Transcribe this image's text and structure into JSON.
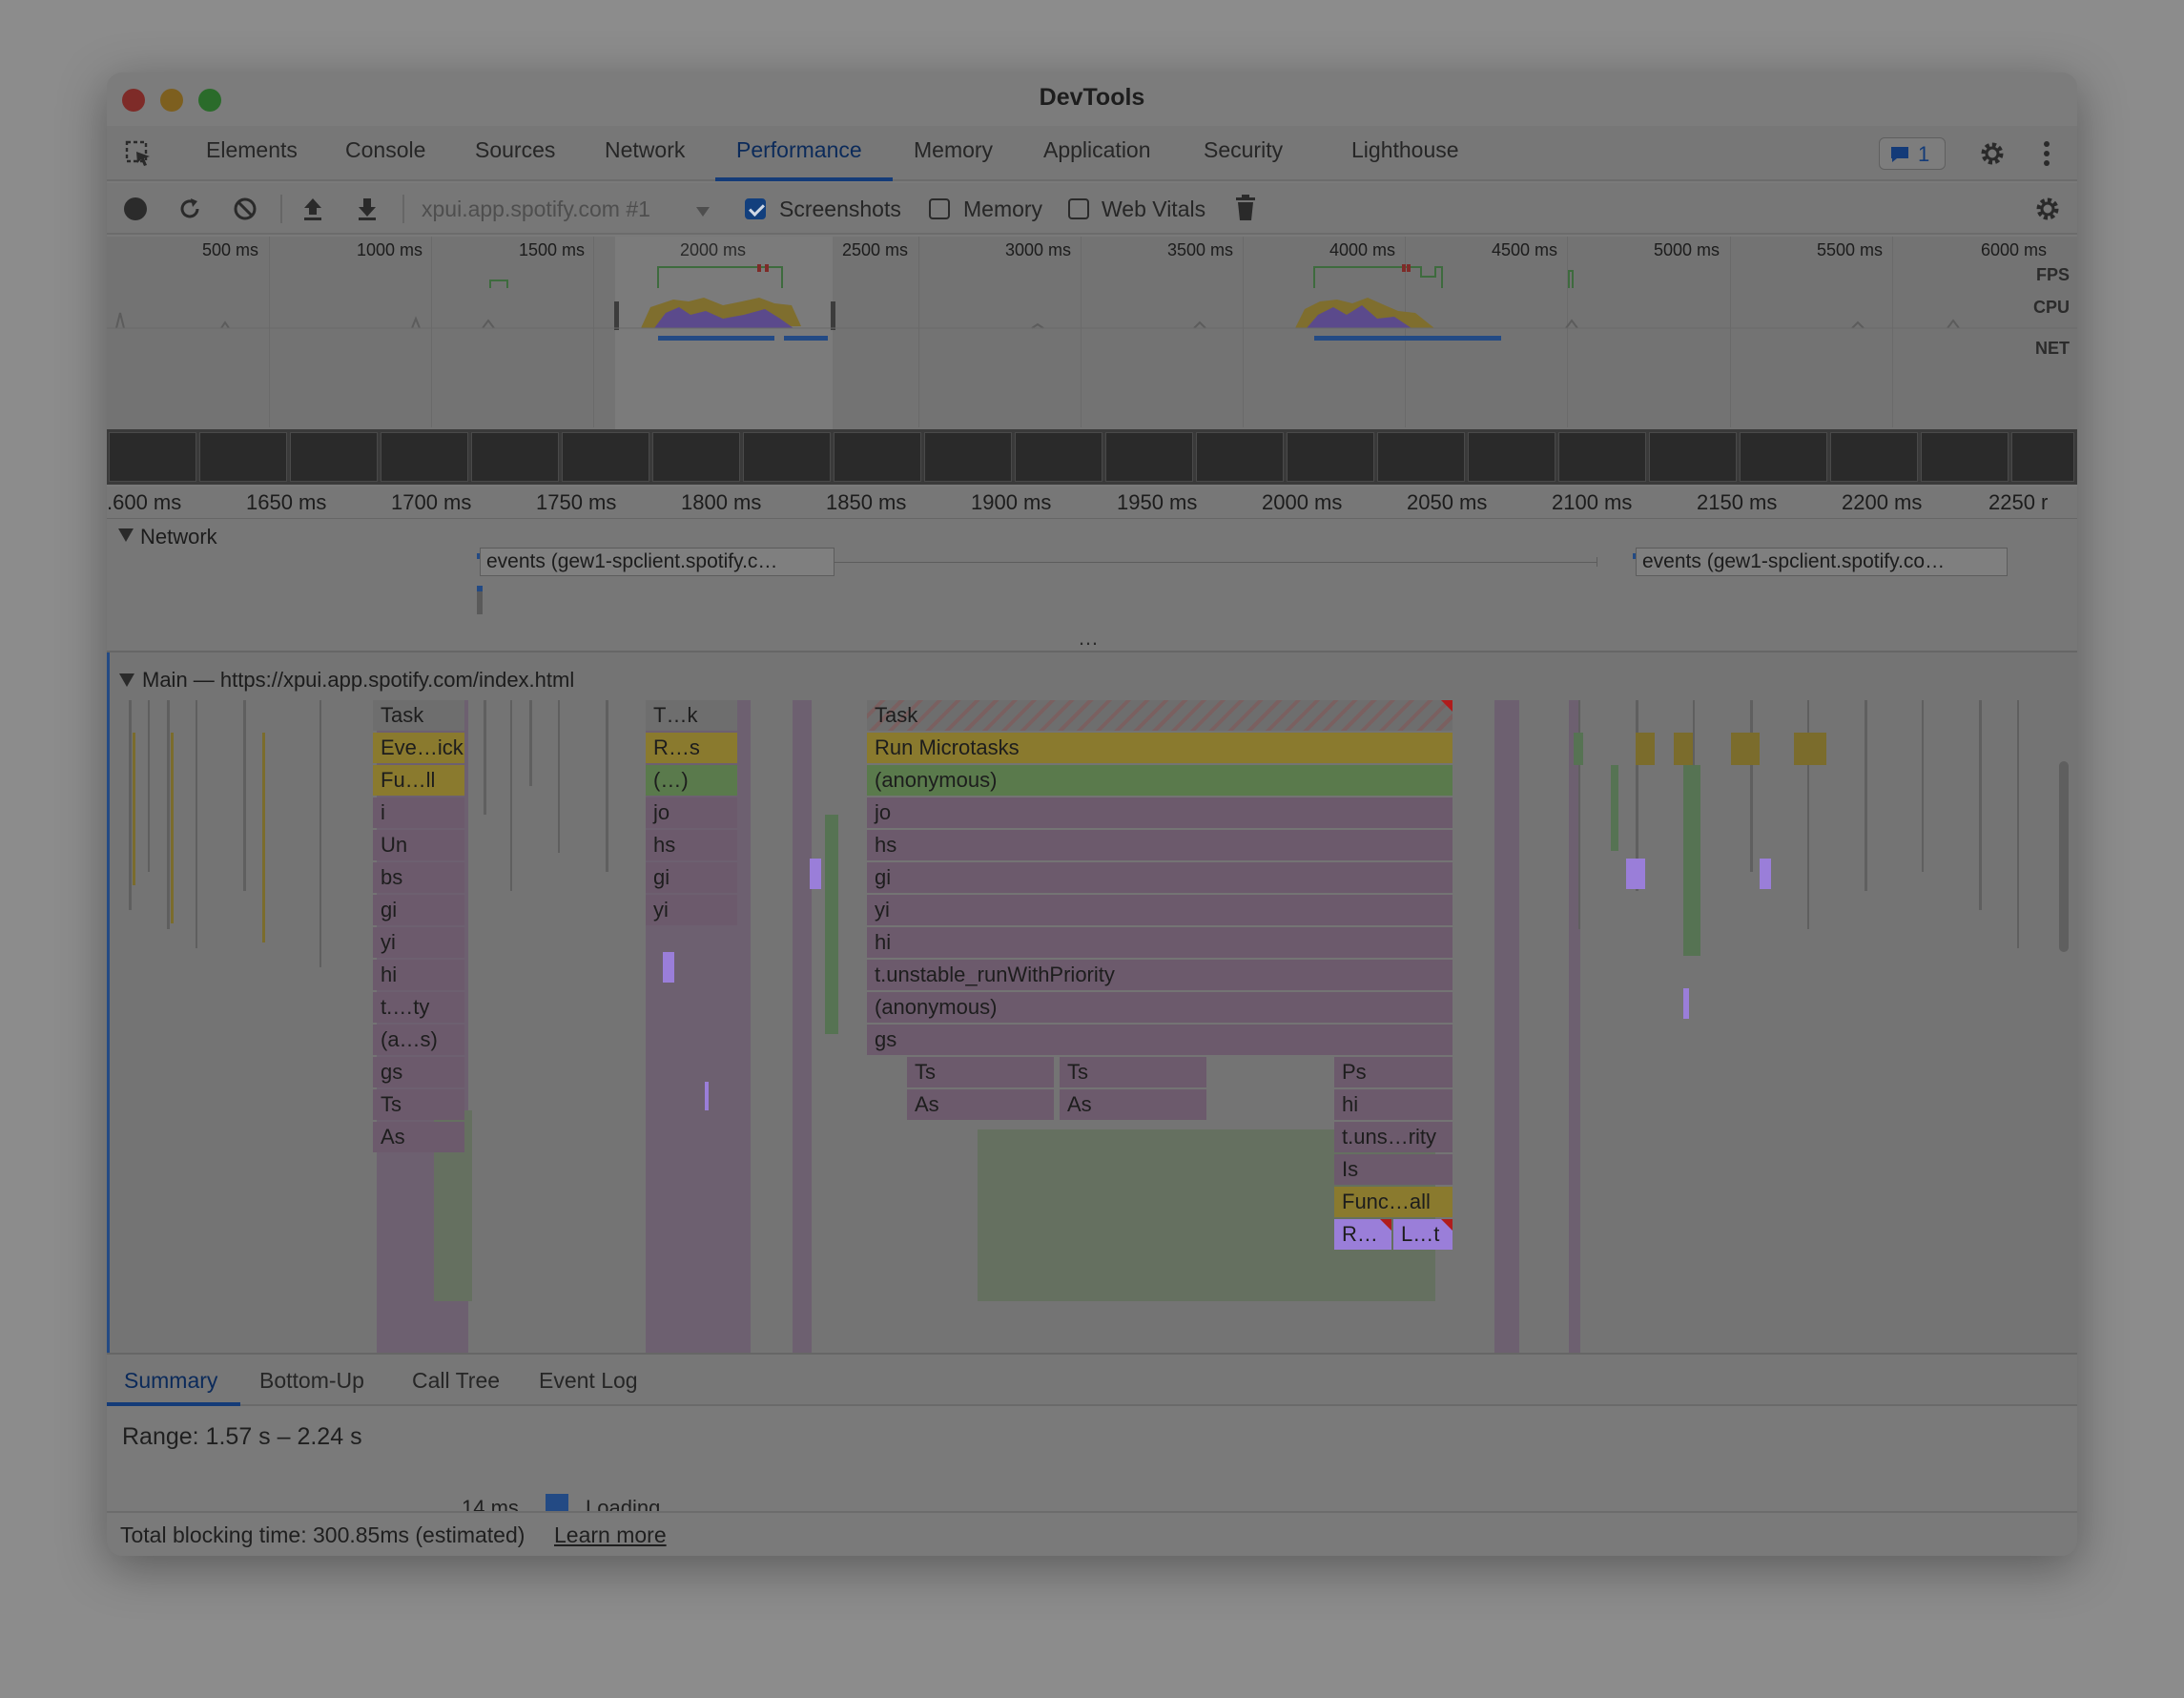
{
  "window": {
    "title": "DevTools"
  },
  "tabs": [
    "Elements",
    "Console",
    "Sources",
    "Network",
    "Performance",
    "Memory",
    "Application",
    "Security",
    "Lighthouse"
  ],
  "active_tab": "Performance",
  "issues_badge": {
    "count": "1"
  },
  "toolbar": {
    "profile_select": "xpui.app.spotify.com #1",
    "screenshots_label": "Screenshots",
    "screenshots_checked": true,
    "memory_label": "Memory",
    "memory_checked": false,
    "web_vitals_label": "Web Vitals",
    "web_vitals_checked": false
  },
  "overview": {
    "ticks": [
      "500 ms",
      "1000 ms",
      "1500 ms",
      "2000 ms",
      "2500 ms",
      "3000 ms",
      "3500 ms",
      "4000 ms",
      "4500 ms",
      "5000 ms",
      "5500 ms",
      "6000 ms"
    ],
    "lanes": [
      "FPS",
      "CPU",
      "NET"
    ]
  },
  "ruler": {
    "ticks": [
      ".600 ms",
      "1650 ms",
      "1700 ms",
      "1750 ms",
      "1800 ms",
      "1850 ms",
      "1900 ms",
      "1950 ms",
      "2000 ms",
      "2050 ms",
      "2100 ms",
      "2150 ms",
      "2200 ms",
      "2250 r"
    ]
  },
  "network_track": {
    "title": "Network",
    "requests": [
      "events (gew1-spclient.spotify.c…",
      "events (gew1-spclient.spotify.co…"
    ],
    "more": "…"
  },
  "main_track": {
    "title": "Main — https://xpui.app.spotify.com/index.html",
    "col1": [
      "Task",
      "Eve…ick",
      "Fu…ll",
      "i",
      "Un",
      "bs",
      "gi",
      "yi",
      "hi",
      "t.…ty",
      "(a…s)",
      "gs",
      "Ts",
      "As"
    ],
    "col2": [
      "T…k",
      "R…s",
      "(…)",
      "jo",
      "hs",
      "gi",
      "yi"
    ],
    "col3": [
      "Task",
      "Run Microtasks",
      "(anonymous)",
      "jo",
      "hs",
      "gi",
      "yi",
      "hi",
      "t.unstable_runWithPriority",
      "(anonymous)",
      "gs"
    ],
    "col3_split": {
      "ts1": "Ts",
      "as1": "As",
      "ts2": "Ts",
      "as2": "As"
    },
    "col4": [
      "Ps",
      "hi",
      "t.uns…rity",
      "Is",
      "Func…all"
    ],
    "col4_leaves": [
      "R…",
      "L…t"
    ]
  },
  "bottom_tabs": [
    "Summary",
    "Bottom-Up",
    "Call Tree",
    "Event Log"
  ],
  "active_bottom_tab": "Summary",
  "summary": {
    "range": "Range: 1.57 s – 2.24 s",
    "legend_value": "14 ms",
    "legend_label": "Loading"
  },
  "footer": {
    "text": "Total blocking time: 300.85ms (estimated)",
    "link": "Learn more"
  },
  "colors": {
    "scripting": "#8a7a2e",
    "function": "#6c5a6c",
    "green": "#5a7a4c",
    "purple": "#9a7ed9",
    "accent": "#143b78"
  }
}
